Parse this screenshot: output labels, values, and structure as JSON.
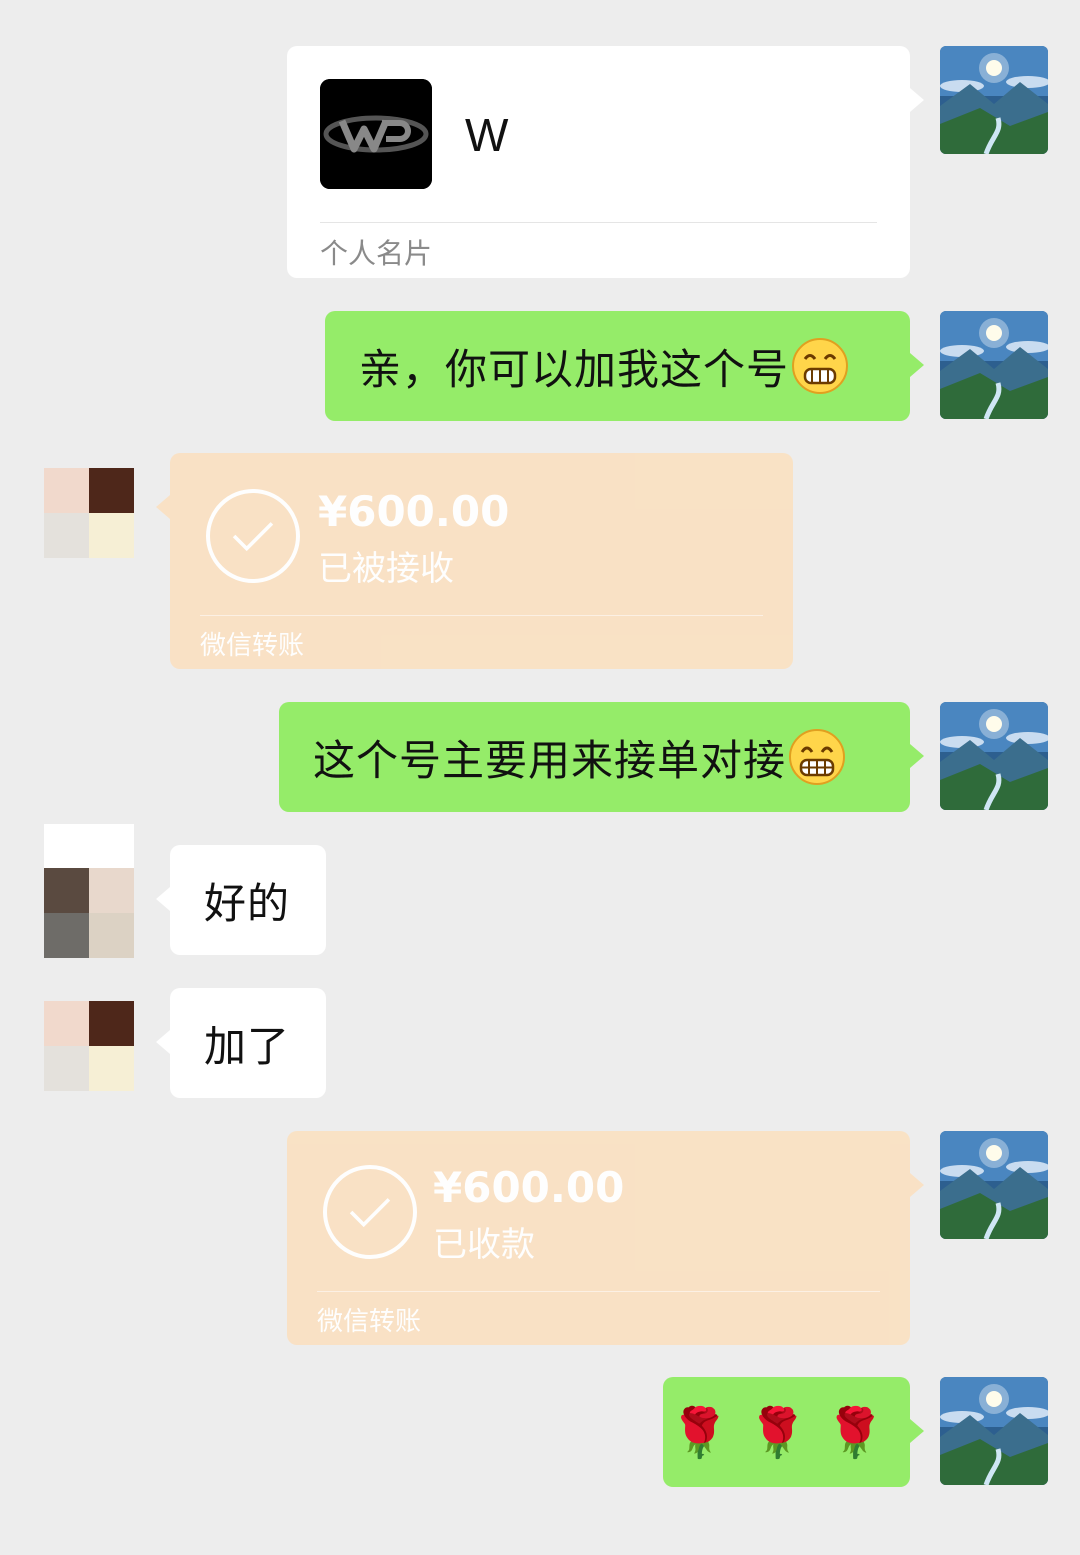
{
  "messages": {
    "m1": {
      "type": "contact_card",
      "name": "W",
      "label": "个人名片"
    },
    "m2": {
      "type": "text",
      "text": "亲，你可以加我这个号",
      "emoji": "grinning-face-icon"
    },
    "m3": {
      "type": "transfer",
      "amount": "¥600.00",
      "status": "已被接收",
      "footer": "微信转账"
    },
    "m4": {
      "type": "text",
      "text": "这个号主要用来接单对接",
      "emoji": "grinning-face-icon"
    },
    "m5": {
      "type": "text",
      "text": "好的"
    },
    "m6": {
      "type": "text",
      "text": "加了"
    },
    "m7": {
      "type": "transfer",
      "amount": "¥600.00",
      "status": "已收款",
      "footer": "微信转账"
    },
    "m8": {
      "type": "text",
      "text": "🌹🌹🌹"
    }
  },
  "colors": {
    "background": "#ededed",
    "self_bubble": "#95ec69",
    "other_bubble": "#ffffff",
    "transfer_card": "#fae1c3"
  }
}
